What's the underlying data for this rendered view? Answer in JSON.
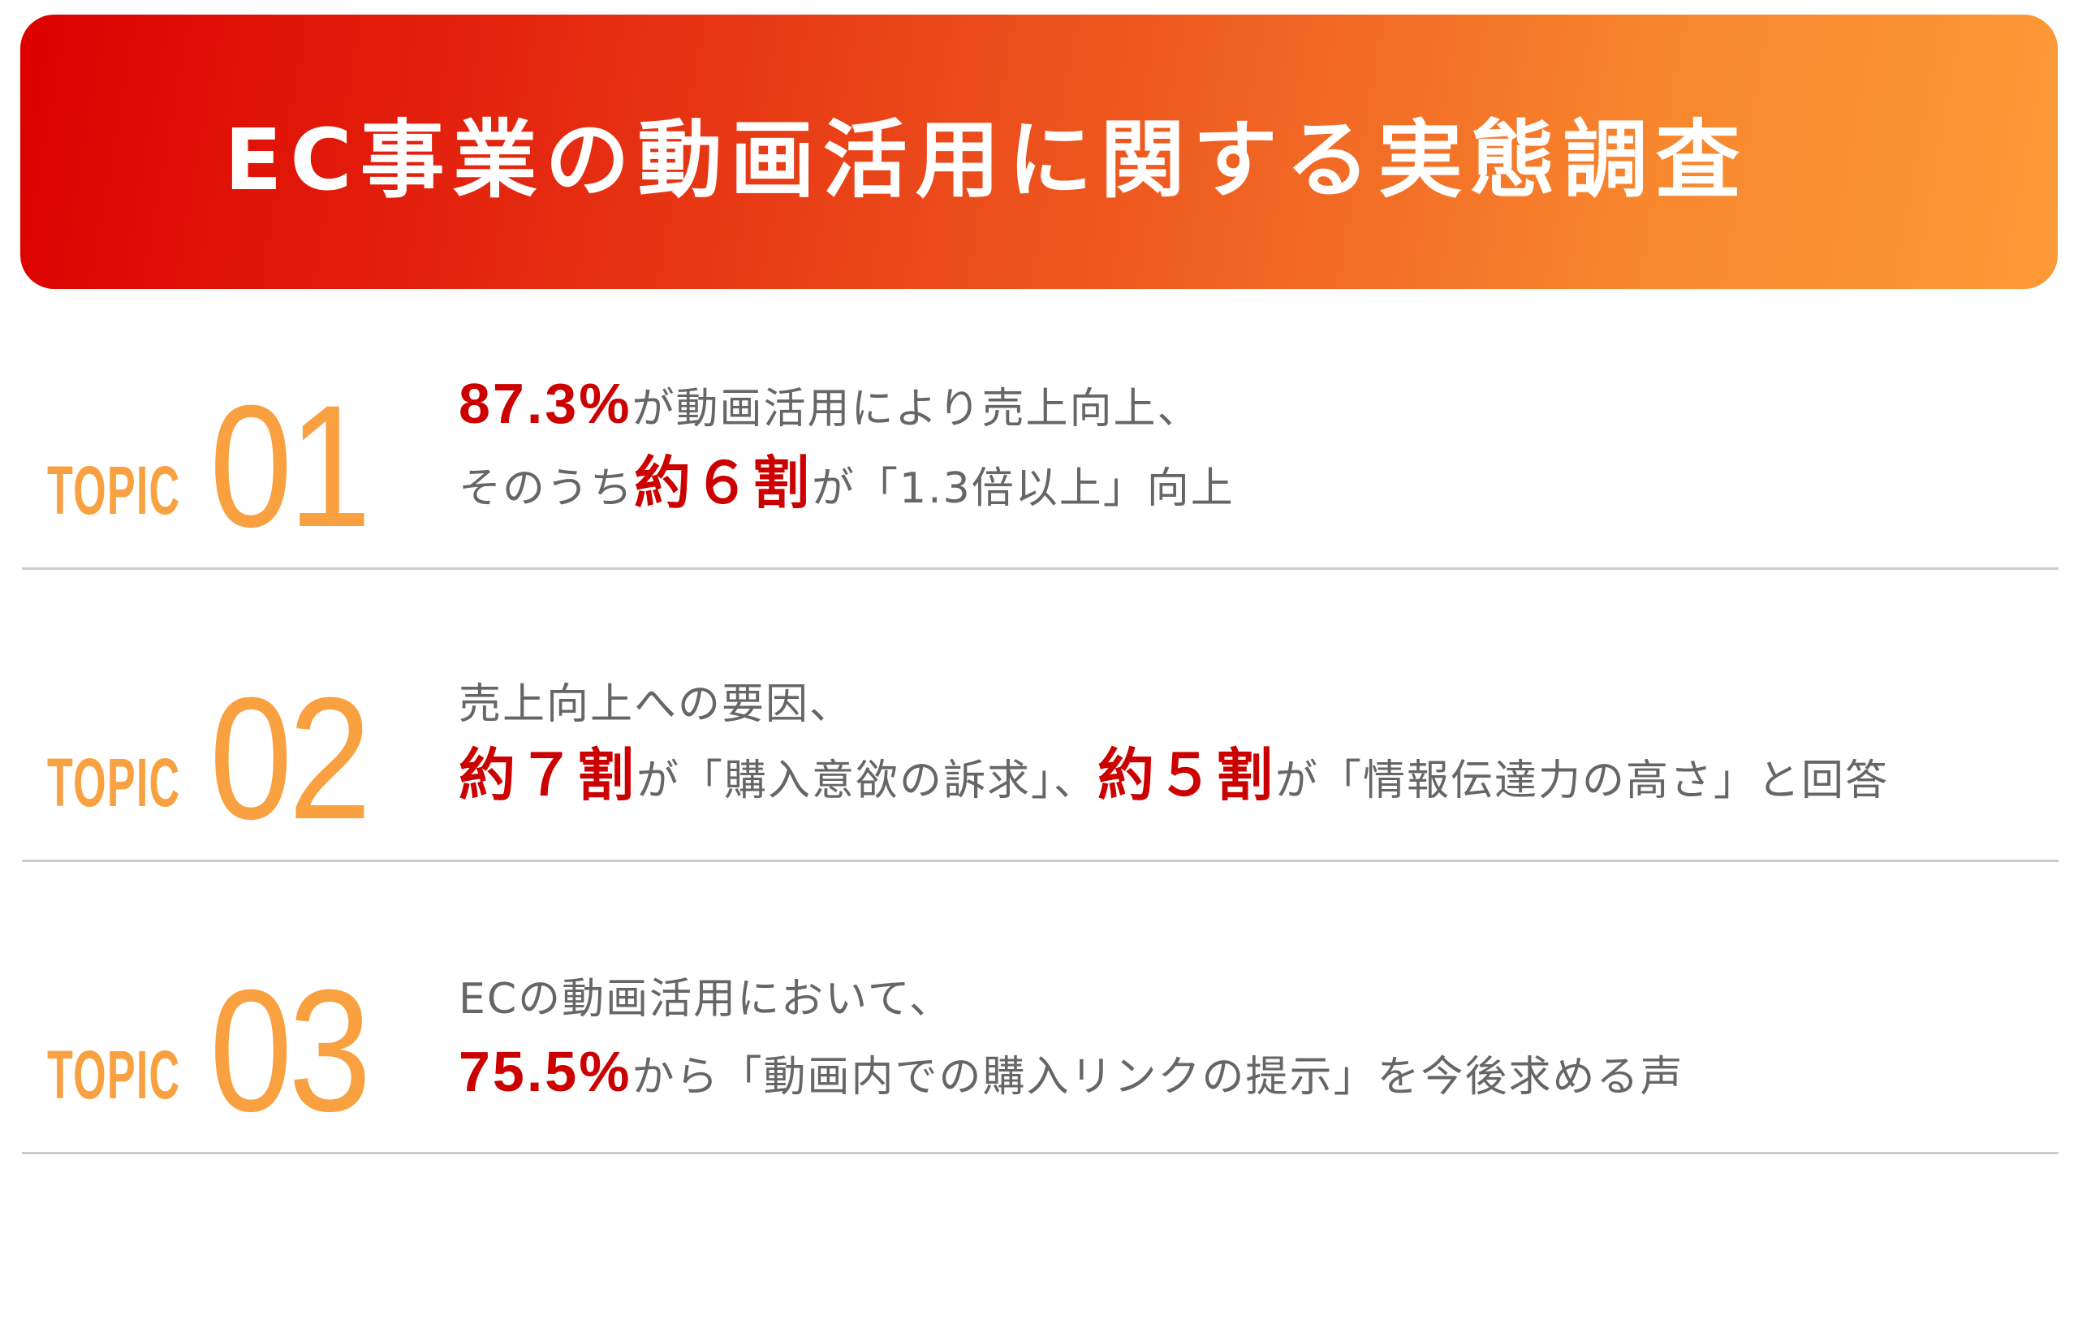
{
  "header": {
    "title": "EC事業の動画活用に関する実態調査"
  },
  "colors": {
    "banner_gradient_start": "#dc0000",
    "banner_gradient_end": "#fc9a37",
    "topic_accent": "#f9a040",
    "highlight": "#cc0000",
    "body_text": "#666666",
    "divider": "#cccccc"
  },
  "topics": [
    {
      "label": "TOPIC",
      "number": "01",
      "line1": [
        {
          "text": "87.3%",
          "highlight": true
        },
        {
          "text": "が動画活用により売上向上、",
          "highlight": false
        }
      ],
      "line2": [
        {
          "text": "そのうち",
          "highlight": false
        },
        {
          "text": "約６割",
          "highlight": true
        },
        {
          "text": "が「1.3倍以上」向上",
          "highlight": false
        }
      ]
    },
    {
      "label": "TOPIC",
      "number": "02",
      "line1": [
        {
          "text": "売上向上への要因、",
          "highlight": false
        }
      ],
      "line2": [
        {
          "text": "約７割",
          "highlight": true
        },
        {
          "text": "が「購入意欲の訴求」、",
          "highlight": false
        },
        {
          "text": "約５割",
          "highlight": true
        },
        {
          "text": "が「情報伝達力の高さ」と回答",
          "highlight": false
        }
      ]
    },
    {
      "label": "TOPIC",
      "number": "03",
      "line1": [
        {
          "text": "ECの動画活用において、",
          "highlight": false
        }
      ],
      "line2": [
        {
          "text": "75.5%",
          "highlight": true
        },
        {
          "text": "から「動画内での購入リンクの提示」を今後求める声",
          "highlight": false
        }
      ]
    }
  ]
}
